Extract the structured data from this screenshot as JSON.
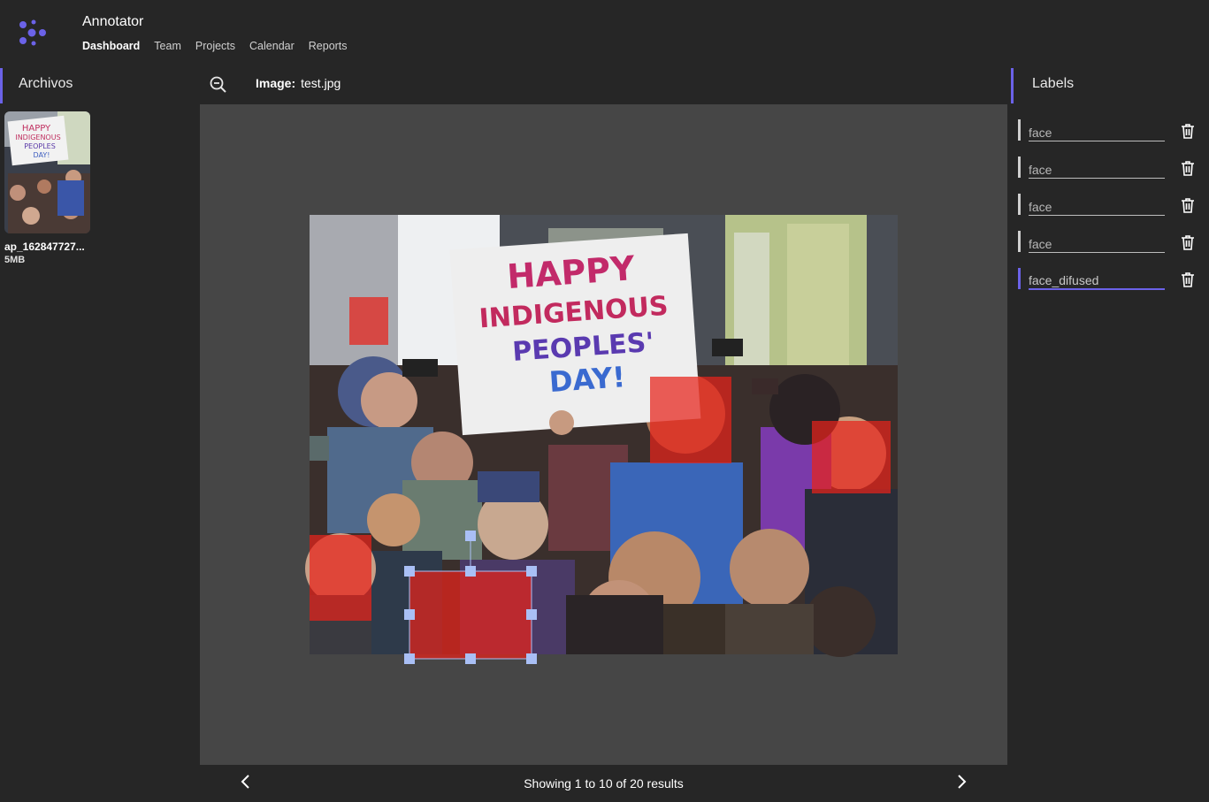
{
  "app": {
    "title": "Annotator"
  },
  "nav": [
    {
      "label": "Dashboard",
      "active": true
    },
    {
      "label": "Team"
    },
    {
      "label": "Projects"
    },
    {
      "label": "Calendar"
    },
    {
      "label": "Reports"
    }
  ],
  "files": {
    "heading": "Archivos",
    "items": [
      {
        "name": "ap_162847727...",
        "size": "5MB"
      }
    ]
  },
  "viewer": {
    "image_prefix": "Image:",
    "image_name": "test.jpg",
    "sign_lines": [
      "HAPPY",
      "INDIGENOUS",
      "PEOPLES'",
      "DAY!"
    ],
    "pagination_text": "Showing 1 to 10 of 20 results"
  },
  "labels": {
    "heading": "Labels",
    "items": [
      {
        "value": "face"
      },
      {
        "value": "face"
      },
      {
        "value": "face"
      },
      {
        "value": "face"
      },
      {
        "value": "face_difused",
        "active": true
      }
    ]
  },
  "colors": {
    "accent": "#6b62e8",
    "box_fill": "#e8231a",
    "handle": "#a9bff5"
  }
}
